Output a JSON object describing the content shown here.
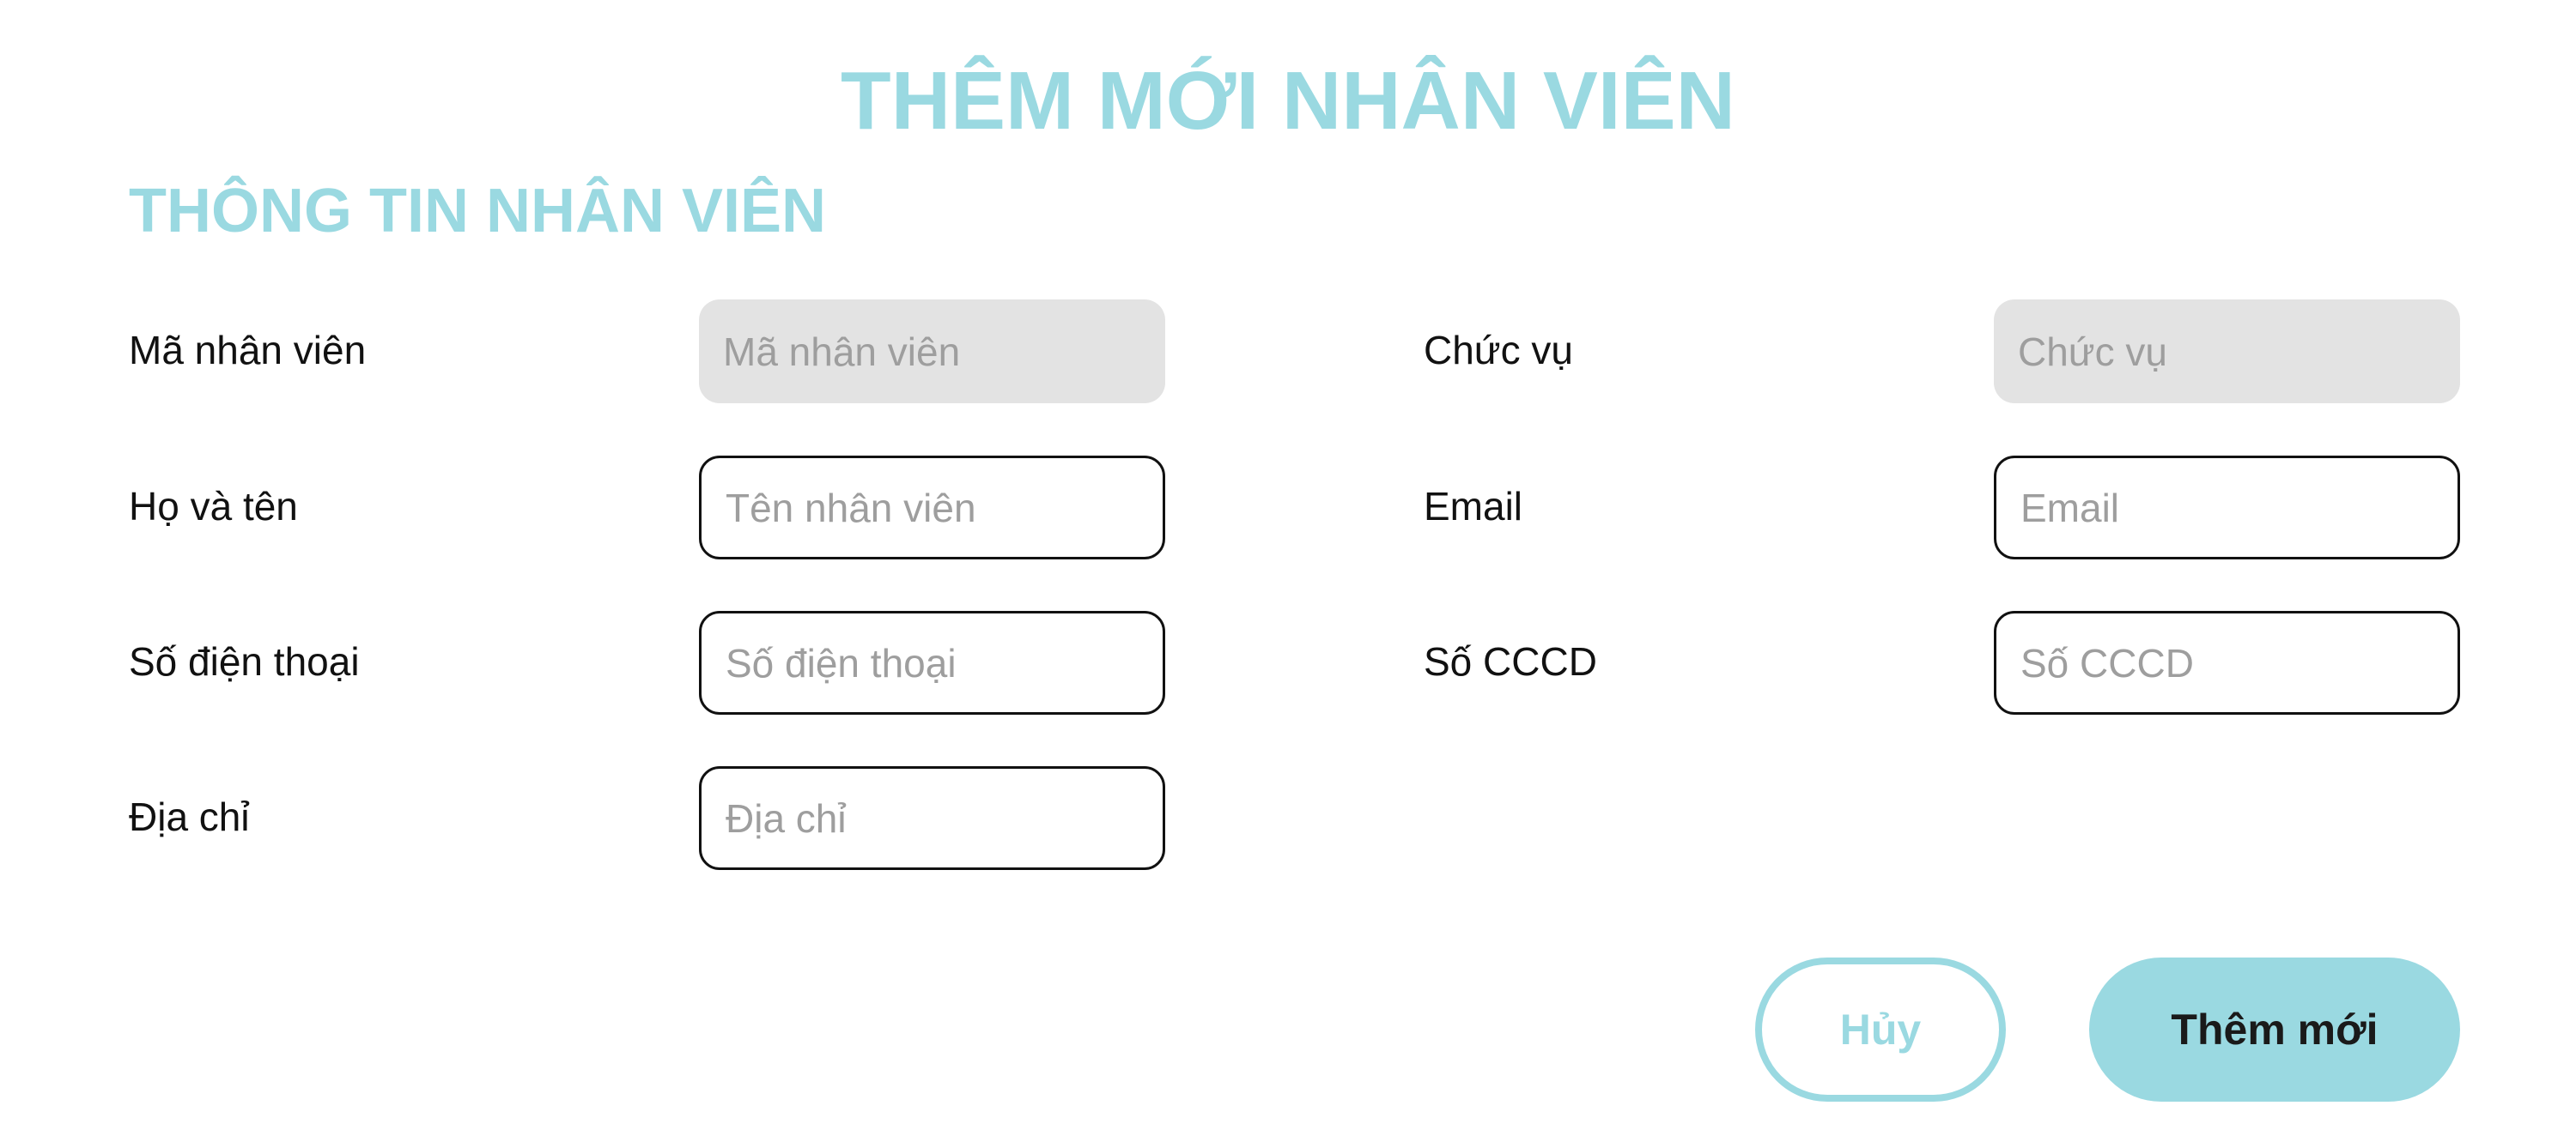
{
  "header": {
    "title": "THÊM MỚI NHÂN VIÊN"
  },
  "section": {
    "title": "THÔNG TIN NHÂN VIÊN"
  },
  "fields": {
    "employee_code": {
      "label": "Mã nhân viên",
      "placeholder": "Mã nhân viên",
      "value": ""
    },
    "full_name": {
      "label": "Họ và tên",
      "placeholder": "Tên nhân viên",
      "value": ""
    },
    "phone": {
      "label": "Số điện thoại",
      "placeholder": "Số điện thoại",
      "value": ""
    },
    "address": {
      "label": "Địa chỉ",
      "placeholder": "Địa chỉ",
      "value": ""
    },
    "position": {
      "label": "Chức vụ",
      "placeholder": "Chức vụ",
      "value": ""
    },
    "email": {
      "label": "Email",
      "placeholder": "Email",
      "value": ""
    },
    "citizen_id": {
      "label": "Số CCCD",
      "placeholder": "Số CCCD",
      "value": ""
    }
  },
  "actions": {
    "cancel_label": "Hủy",
    "submit_label": "Thêm mới"
  },
  "colors": {
    "accent": "#9ad9e1",
    "readonly_bg": "#e3e3e3",
    "border": "#111111",
    "placeholder": "#9e9e9e"
  }
}
